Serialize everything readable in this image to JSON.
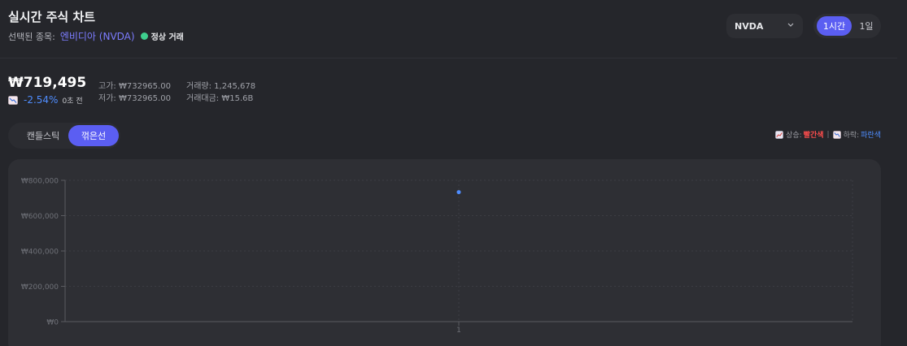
{
  "header": {
    "title": "실시간 주식 차트",
    "selected_label": "선택된 종목:",
    "stock_name": "엔비디아 (NVDA)",
    "status": "정상 거래",
    "status_color": "#3ecf8e"
  },
  "controls": {
    "symbol_select": "NVDA",
    "periods": [
      "1시간",
      "1일"
    ],
    "active_period": "1시간"
  },
  "quote": {
    "price": "₩719,495",
    "change": "-2.54%",
    "updated": "0초 전",
    "high_label": "고가:",
    "high_value": "₩732965.00",
    "low_label": "저가:",
    "low_value": "₩732965.00",
    "volume_label": "거래량:",
    "volume_value": "1,245,678",
    "turnover_label": "거래대금:",
    "turnover_value": "₩15.6B"
  },
  "chart_type_toggle": {
    "options": [
      "캔들스틱",
      "꺾은선"
    ],
    "active": "꺾은선"
  },
  "legend": {
    "up_label": "상승:",
    "up_color_name": "빨간색",
    "separator": "|",
    "down_label": "하락:",
    "down_color_name": "파란색"
  },
  "colors": {
    "accent": "#5b5ef2",
    "up": "#ff4d4d",
    "down": "#4f8dff",
    "point": "#4f8dff"
  },
  "chart_data": {
    "type": "line",
    "x": [
      "1"
    ],
    "series": [
      {
        "values": [
          732965
        ]
      }
    ],
    "ylim": [
      0,
      800000
    ],
    "yticks": [
      "₩800,000",
      "₩600,000",
      "₩400,000",
      "₩200,000",
      "₩0"
    ],
    "ytick_values": [
      800000,
      600000,
      400000,
      200000,
      0
    ],
    "grid": true
  }
}
